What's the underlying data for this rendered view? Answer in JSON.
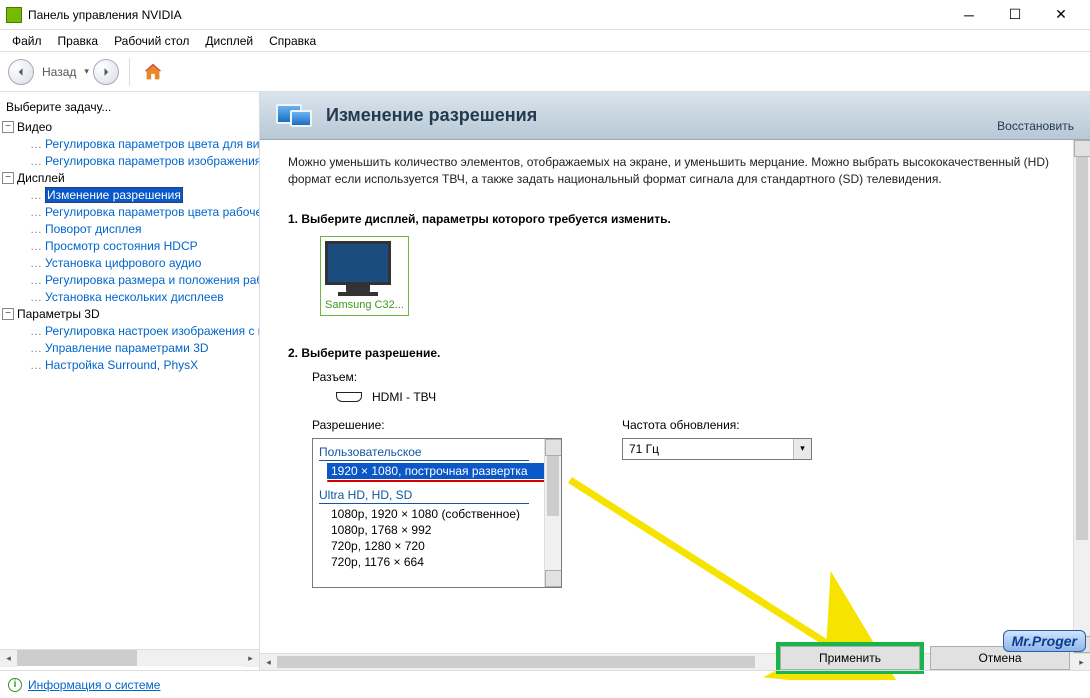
{
  "window": {
    "title": "Панель управления NVIDIA"
  },
  "menu": {
    "file": "Файл",
    "edit": "Правка",
    "desktop": "Рабочий стол",
    "display": "Дисплей",
    "help": "Справка"
  },
  "nav": {
    "back": "Назад"
  },
  "sidebar": {
    "header": "Выберите задачу...",
    "groups": [
      {
        "label": "Видео",
        "items": [
          "Регулировка параметров цвета для вид",
          "Регулировка параметров изображения д"
        ]
      },
      {
        "label": "Дисплей",
        "items": [
          "Изменение разрешения",
          "Регулировка параметров цвета рабочег",
          "Поворот дисплея",
          "Просмотр состояния HDCP",
          "Установка цифрового аудио",
          "Регулировка размера и положения рабо",
          "Установка нескольких дисплеев"
        ]
      },
      {
        "label": "Параметры 3D",
        "items": [
          "Регулировка настроек изображения с пр",
          "Управление параметрами 3D",
          "Настройка Surround, PhysX"
        ]
      }
    ],
    "selected": "Изменение разрешения"
  },
  "page": {
    "title": "Изменение разрешения",
    "restore": "Восстановить",
    "intro": "Можно уменьшить количество элементов, отображаемых на экране, и уменьшить мерцание. Можно выбрать высококачественный (HD) формат если используется ТВЧ, а также задать национальный формат сигнала для стандартного (SD) телевидения.",
    "step1": "1. Выберите дисплей, параметры которого требуется изменить.",
    "display_name": "Samsung C32...",
    "step2": "2. Выберите разрешение.",
    "connector_label": "Разъем:",
    "connector_value": "HDMI - ТВЧ",
    "resolution_label": "Разрешение:",
    "refresh_label": "Частота обновления:",
    "refresh_value": "71 Гц",
    "resolutions": {
      "group1": "Пользовательское",
      "selected": "1920 × 1080, построчная развертка",
      "group2": "Ultra HD, HD, SD",
      "items": [
        "1080p, 1920 × 1080 (собственное)",
        "1080p, 1768 × 992",
        "720p, 1280 × 720",
        "720p, 1176 × 664"
      ]
    }
  },
  "buttons": {
    "apply": "Применить",
    "cancel": "Отмена"
  },
  "status": {
    "info": "Информация о системе"
  },
  "watermark": "Mr.Proger"
}
